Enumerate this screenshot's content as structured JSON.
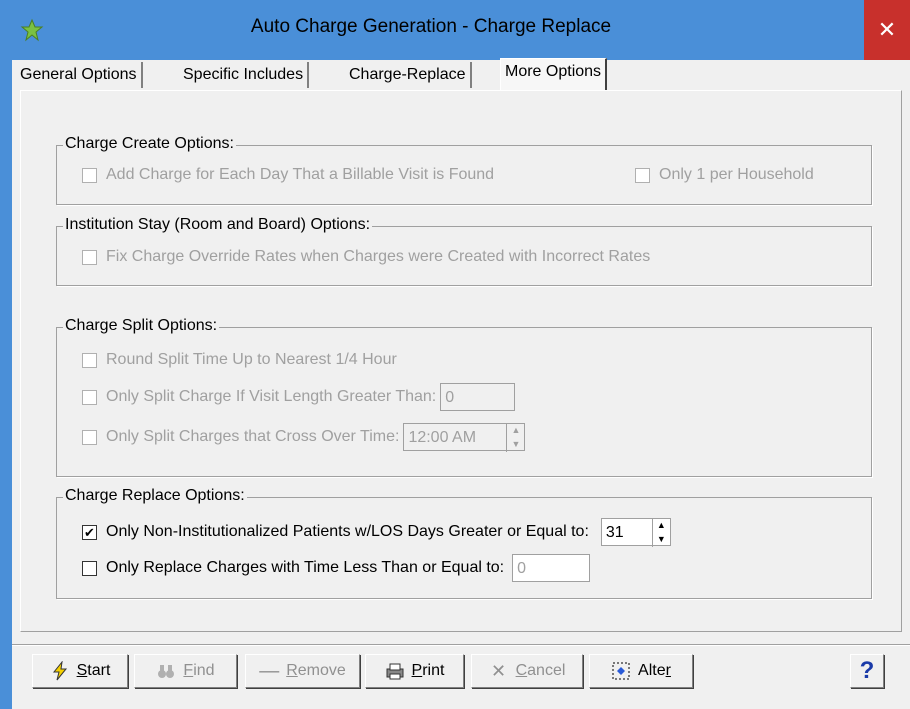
{
  "window": {
    "title": "Auto Charge Generation - Charge Replace",
    "close_glyph": "✕",
    "accent_color": "#4a8fd8"
  },
  "tabs": [
    {
      "label": "General Options"
    },
    {
      "label": "Specific Includes"
    },
    {
      "label": "Charge-Replace"
    },
    {
      "label": "More Options",
      "active": true
    }
  ],
  "charge_create": {
    "legend": "Charge Create Options:",
    "add_charge_each_day": {
      "label": "Add Charge for Each Day That a Billable Visit is Found",
      "checked": false,
      "enabled": false
    },
    "only_one_per_household": {
      "label": "Only 1 per Household",
      "checked": false,
      "enabled": false
    }
  },
  "institution_stay": {
    "legend": "Institution Stay (Room and Board) Options:",
    "fix_override_rates": {
      "label": "Fix Charge Override Rates when Charges were Created with Incorrect Rates",
      "checked": false,
      "enabled": false
    }
  },
  "charge_split": {
    "legend": "Charge Split Options:",
    "round_split": {
      "label": "Round Split Time Up to Nearest 1/4 Hour",
      "checked": false,
      "enabled": false
    },
    "split_visit_length": {
      "label": "Only Split Charge If Visit Length Greater Than:",
      "checked": false,
      "enabled": false,
      "value": "0"
    },
    "split_cross_time": {
      "label": "Only Split Charges that Cross Over Time:",
      "checked": false,
      "enabled": false,
      "value": "12:00 AM"
    }
  },
  "charge_replace": {
    "legend": "Charge Replace Options:",
    "non_institutionalized": {
      "label": "Only Non-Institutionalized Patients w/LOS Days Greater or Equal to:",
      "checked": true,
      "enabled": true,
      "value": "31"
    },
    "replace_time_less": {
      "label": "Only Replace Charges with Time Less Than or Equal to:",
      "checked": false,
      "enabled": true,
      "value": "0"
    }
  },
  "toolbar": {
    "start": {
      "label_u": "S",
      "label_rest": "tart",
      "enabled": true
    },
    "find": {
      "label_u": "F",
      "label_rest": "ind",
      "enabled": false
    },
    "remove": {
      "label_pre": "",
      "label_u": "R",
      "label_rest": "emove",
      "enabled": false
    },
    "print": {
      "label_u": "P",
      "label_rest": "rint",
      "enabled": true
    },
    "cancel": {
      "label_u": "C",
      "label_rest": "ancel",
      "enabled": false
    },
    "alter": {
      "label_pre": "Alte",
      "label_u": "r",
      "enabled": true
    },
    "help": {
      "glyph": "?"
    }
  },
  "glyphs": {
    "check": "✔",
    "spin_up": "▲",
    "spin_down": "▼"
  }
}
